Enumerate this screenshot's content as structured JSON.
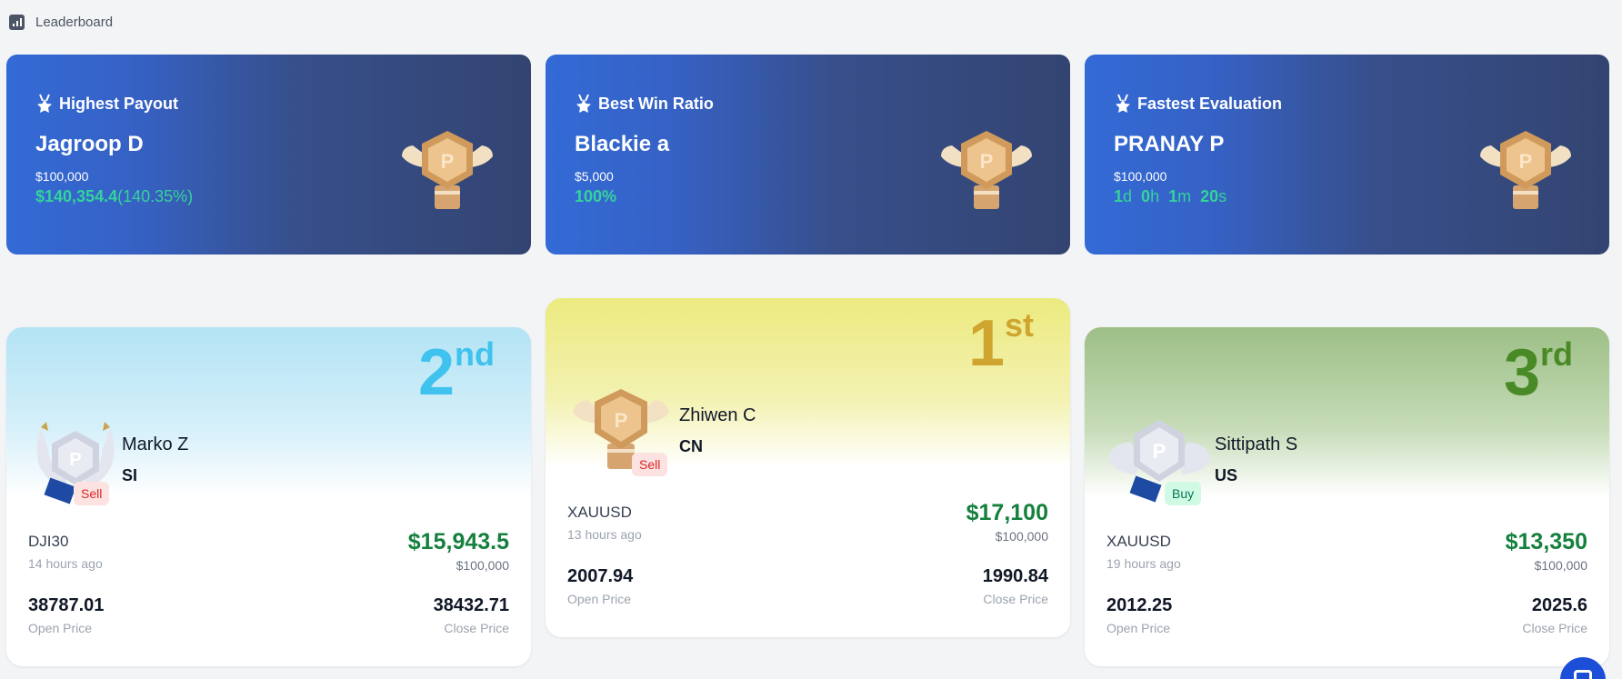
{
  "header": {
    "title": "Leaderboard",
    "icon": "bar-chart-icon"
  },
  "awards": [
    {
      "category": "Highest Payout",
      "name": "Jagroop D",
      "amount": "$100,000",
      "metric_main": "$140,354.4",
      "metric_sub": "(140.35%)"
    },
    {
      "category": "Best Win Ratio",
      "name": "Blackie a",
      "amount": "$5,000",
      "metric_main": "100%"
    },
    {
      "category": "Fastest Evaluation",
      "name": "PRANAY P",
      "amount": "$100,000",
      "duration": {
        "d": "1",
        "d_unit": "d",
        "h": "0",
        "h_unit": "h",
        "m": "1",
        "m_unit": "m",
        "s": "20",
        "s_unit": "s"
      }
    }
  ],
  "ranks": {
    "second": {
      "rank_num": "2",
      "rank_suffix": "nd",
      "name": "Marko Z",
      "country": "SI",
      "side": "Sell",
      "symbol": "DJI30",
      "time": "14 hours ago",
      "pnl": "$15,943.5",
      "account": "$100,000",
      "open_price": "38787.01",
      "open_label": "Open Price",
      "close_price": "38432.71",
      "close_label": "Close Price",
      "medal": "silver"
    },
    "first": {
      "rank_num": "1",
      "rank_suffix": "st",
      "name": "Zhiwen C",
      "country": "CN",
      "side": "Sell",
      "symbol": "XAUUSD",
      "time": "13 hours ago",
      "pnl": "$17,100",
      "account": "$100,000",
      "open_price": "2007.94",
      "open_label": "Open Price",
      "close_price": "1990.84",
      "close_label": "Close Price",
      "medal": "gold"
    },
    "third": {
      "rank_num": "3",
      "rank_suffix": "rd",
      "name": "Sittipath S",
      "country": "US",
      "side": "Buy",
      "symbol": "XAUUSD",
      "time": "19 hours ago",
      "pnl": "$13,350",
      "account": "$100,000",
      "open_price": "2012.25",
      "open_label": "Open Price",
      "close_price": "2025.6",
      "close_label": "Close Price",
      "medal": "silver"
    }
  },
  "colors": {
    "gold": "#cfa52f",
    "second": "#3fc3ee",
    "third": "#4a8a26",
    "profit": "#15803d",
    "award_metric": "#34d399"
  }
}
